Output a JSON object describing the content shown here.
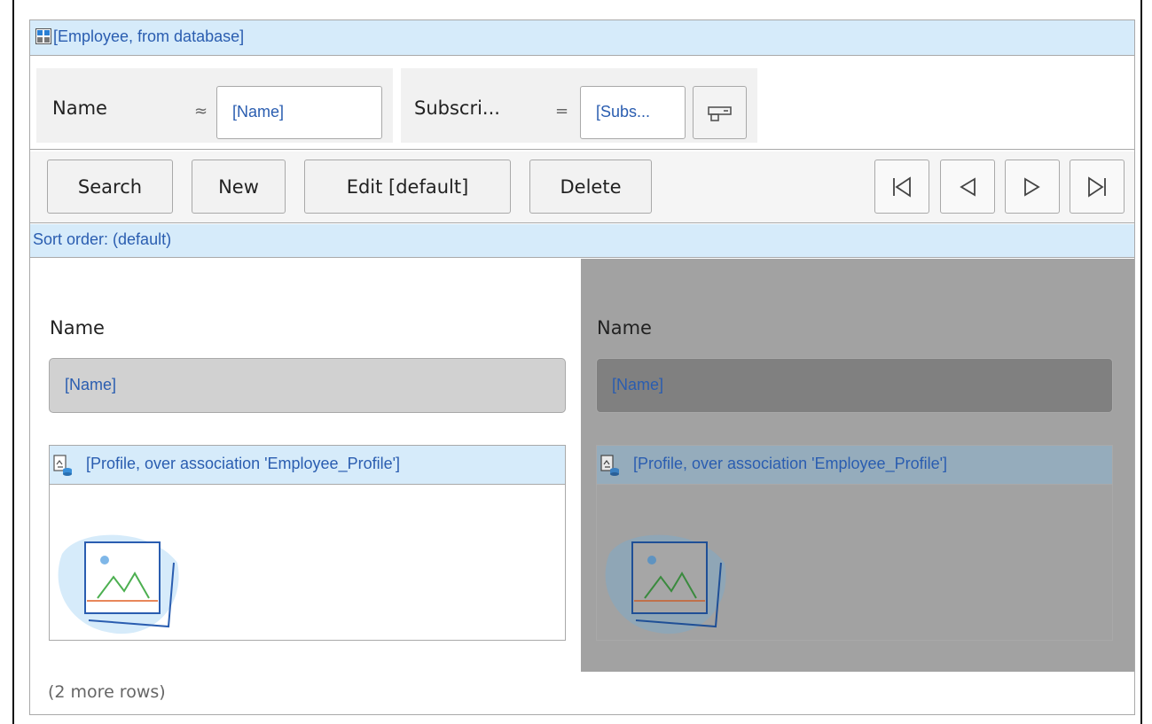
{
  "header": {
    "title": "[Employee, from database]"
  },
  "filters": [
    {
      "label": "Name",
      "operator": "≈",
      "value": "[Name]"
    },
    {
      "label": "Subscri...",
      "operator": "=",
      "value": "[Subs..."
    }
  ],
  "toolbar": {
    "search_label": "Search",
    "new_label": "New",
    "edit_label": "Edit [default]",
    "delete_label": "Delete"
  },
  "sort": {
    "label": "Sort order: (default)"
  },
  "rows": [
    {
      "name_label": "Name",
      "name_value": "[Name]",
      "ref_title": "[Profile, over association 'Employee_Profile']"
    },
    {
      "name_label": "Name",
      "name_value": "[Name]",
      "ref_title": "[Profile, over association 'Employee_Profile']"
    }
  ],
  "footer": {
    "more_rows": "(2 more rows)"
  },
  "colors": {
    "header_bg": "#d6ebfa",
    "link_text": "#2a5db0",
    "selected_bg": "#a2a2a2"
  },
  "icons": {
    "header": "list-view-icon",
    "filter_options": "options-icon",
    "nav": [
      "first-page-icon",
      "previous-page-icon",
      "next-page-icon",
      "last-page-icon"
    ],
    "reference": "reference-data-icon",
    "image_placeholder": "image-placeholder-icon"
  }
}
